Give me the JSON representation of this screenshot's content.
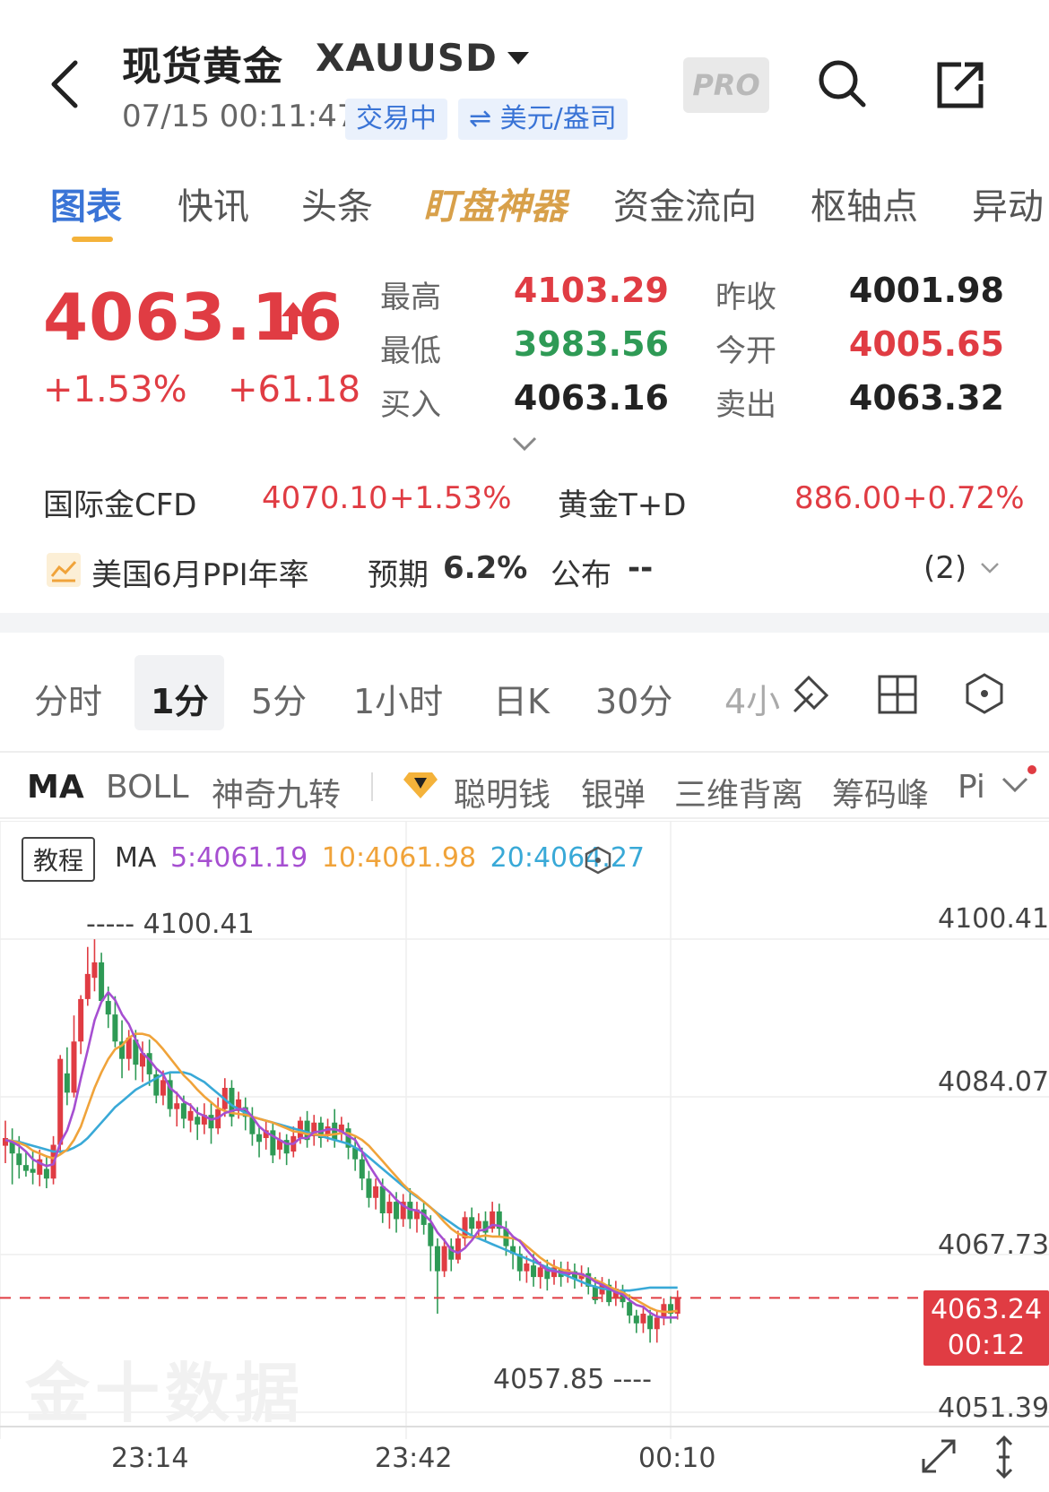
{
  "header": {
    "title": "现货黄金",
    "symbol": "XAUUSD",
    "datetime": "07/15 00:11:47",
    "status_badge": "交易中",
    "currency_badge": "⇌ 美元/盎司",
    "pro_label": "PRO",
    "icons": [
      "back-icon",
      "search-icon",
      "share-icon",
      "caret-down-icon"
    ]
  },
  "tabs": [
    {
      "label": "图表",
      "active": true
    },
    {
      "label": "快讯"
    },
    {
      "label": "头条"
    },
    {
      "label": "盯盘神器",
      "special": true
    },
    {
      "label": "资金流向"
    },
    {
      "label": "枢轴点"
    },
    {
      "label": "异动"
    }
  ],
  "quote": {
    "price": "4063.16",
    "change_pct": "+1.53%",
    "change_abs": "+61.18",
    "stats": [
      {
        "label": "最高",
        "value": "4103.29",
        "color": "red"
      },
      {
        "label": "昨收",
        "value": "4001.98",
        "color": "dark"
      },
      {
        "label": "最低",
        "value": "3983.56",
        "color": "green"
      },
      {
        "label": "今开",
        "value": "4005.65",
        "color": "red"
      },
      {
        "label": "买入",
        "value": "4063.16",
        "color": "dark"
      },
      {
        "label": "卖出",
        "value": "4063.32",
        "color": "dark"
      }
    ]
  },
  "related": [
    {
      "label": "国际金CFD",
      "price": "4070.10",
      "change": "+1.53%"
    },
    {
      "label": "黄金T+D",
      "price": "886.00",
      "change": "+0.72%"
    }
  ],
  "event": {
    "title": "美国6月PPI年率",
    "expected_label": "预期",
    "expected_value": "6.2%",
    "published_label": "公布",
    "published_value": "--",
    "count": "(2)"
  },
  "periods": [
    {
      "label": "分时"
    },
    {
      "label": "1分",
      "active": true
    },
    {
      "label": "5分"
    },
    {
      "label": "1小时"
    },
    {
      "label": "日K"
    },
    {
      "label": "30分"
    },
    {
      "label": "4小"
    }
  ],
  "period_icons": [
    "draw-tool-icon",
    "layout-grid-icon",
    "settings-hex-icon"
  ],
  "indicators": [
    "MA",
    "BOLL",
    "神奇九转",
    "聪明钱",
    "银弹",
    "三维背离",
    "筹码峰",
    "Pi"
  ],
  "chart_header": {
    "tutorial_button": "教程",
    "ma_label": "MA",
    "ma5": "5:4061.19",
    "ma10": "10:4061.98",
    "ma20": "20:4064.27"
  },
  "colors": {
    "up": "#e03c43",
    "down": "#2e9a55",
    "ma5": "#a64fd1",
    "ma10": "#f0a33a",
    "ma20": "#39a9d7",
    "accent": "#3a74d6"
  },
  "chart": {
    "y_axis_labels": [
      "4100.41",
      "4084.07",
      "4067.73",
      "4051.39"
    ],
    "x_axis_labels": [
      "23:14",
      "23:42",
      "00:10"
    ],
    "high_marker": "4100.41",
    "low_marker": "4057.85",
    "current_price_tag": "4063.24",
    "current_countdown": "00:12",
    "watermark": "金十数据"
  },
  "chart_data": {
    "type": "candlestick",
    "interval": "1m",
    "ylim": [
      4051.39,
      4100.41
    ],
    "current_price": 4063.24,
    "candles": [
      {
        "o": 4079.0,
        "c": 4079.8,
        "h": 4081.6,
        "l": 4077.2
      },
      {
        "o": 4079.5,
        "c": 4078.2,
        "h": 4080.8,
        "l": 4075.0
      },
      {
        "o": 4078.2,
        "c": 4077.0,
        "h": 4080.0,
        "l": 4075.6
      },
      {
        "o": 4077.0,
        "c": 4076.4,
        "h": 4078.4,
        "l": 4075.8
      },
      {
        "o": 4076.6,
        "c": 4076.2,
        "h": 4078.5,
        "l": 4075.0
      },
      {
        "o": 4076.0,
        "c": 4077.6,
        "h": 4078.6,
        "l": 4074.8
      },
      {
        "o": 4076.6,
        "c": 4075.6,
        "h": 4078.0,
        "l": 4074.6
      },
      {
        "o": 4075.6,
        "c": 4079.1,
        "h": 4080.0,
        "l": 4075.0
      },
      {
        "o": 4079.1,
        "c": 4088.0,
        "h": 4088.4,
        "l": 4078.0
      },
      {
        "o": 4086.5,
        "c": 4084.5,
        "h": 4089.2,
        "l": 4083.2
      },
      {
        "o": 4084.5,
        "c": 4089.8,
        "h": 4092.5,
        "l": 4084.0
      },
      {
        "o": 4089.8,
        "c": 4094.2,
        "h": 4094.6,
        "l": 4088.5
      },
      {
        "o": 4094.2,
        "c": 4096.8,
        "h": 4099.6,
        "l": 4093.5
      },
      {
        "o": 4096.4,
        "c": 4098.0,
        "h": 4100.4,
        "l": 4095.0
      },
      {
        "o": 4098.0,
        "c": 4094.0,
        "h": 4099.0,
        "l": 4093.8
      },
      {
        "o": 4094.0,
        "c": 4092.6,
        "h": 4095.5,
        "l": 4091.2
      },
      {
        "o": 4092.6,
        "c": 4089.8,
        "h": 4094.5,
        "l": 4089.2
      },
      {
        "o": 4089.8,
        "c": 4088.0,
        "h": 4092.0,
        "l": 4086.0
      },
      {
        "o": 4088.0,
        "c": 4090.2,
        "h": 4091.0,
        "l": 4086.8
      },
      {
        "o": 4090.0,
        "c": 4087.4,
        "h": 4091.0,
        "l": 4085.8
      },
      {
        "o": 4087.2,
        "c": 4088.6,
        "h": 4089.8,
        "l": 4085.6
      },
      {
        "o": 4088.6,
        "c": 4086.4,
        "h": 4090.0,
        "l": 4085.2
      },
      {
        "o": 4086.4,
        "c": 4084.2,
        "h": 4087.0,
        "l": 4083.4
      },
      {
        "o": 4084.2,
        "c": 4085.8,
        "h": 4086.8,
        "l": 4083.2
      },
      {
        "o": 4085.8,
        "c": 4082.8,
        "h": 4086.6,
        "l": 4082.0
      },
      {
        "o": 4082.8,
        "c": 4083.4,
        "h": 4084.6,
        "l": 4081.0
      },
      {
        "o": 4083.4,
        "c": 4081.8,
        "h": 4084.2,
        "l": 4080.8
      },
      {
        "o": 4081.6,
        "c": 4082.6,
        "h": 4083.4,
        "l": 4080.4
      },
      {
        "o": 4082.0,
        "c": 4081.2,
        "h": 4083.0,
        "l": 4079.6
      },
      {
        "o": 4081.2,
        "c": 4082.2,
        "h": 4083.4,
        "l": 4080.2
      },
      {
        "o": 4082.2,
        "c": 4080.8,
        "h": 4083.6,
        "l": 4079.2
      },
      {
        "o": 4080.8,
        "c": 4082.8,
        "h": 4084.0,
        "l": 4080.2
      },
      {
        "o": 4082.8,
        "c": 4085.0,
        "h": 4086.0,
        "l": 4082.0
      },
      {
        "o": 4085.0,
        "c": 4082.0,
        "h": 4085.8,
        "l": 4081.0
      },
      {
        "o": 4082.6,
        "c": 4083.8,
        "h": 4084.6,
        "l": 4081.8
      },
      {
        "o": 4083.0,
        "c": 4082.0,
        "h": 4084.0,
        "l": 4080.6
      },
      {
        "o": 4082.0,
        "c": 4080.2,
        "h": 4083.0,
        "l": 4079.0
      },
      {
        "o": 4080.2,
        "c": 4079.4,
        "h": 4081.0,
        "l": 4077.8
      },
      {
        "o": 4079.8,
        "c": 4080.6,
        "h": 4081.6,
        "l": 4078.6
      },
      {
        "o": 4080.6,
        "c": 4078.0,
        "h": 4081.4,
        "l": 4077.2
      },
      {
        "o": 4078.6,
        "c": 4079.6,
        "h": 4080.4,
        "l": 4077.6
      },
      {
        "o": 4079.6,
        "c": 4078.2,
        "h": 4080.2,
        "l": 4077.0
      },
      {
        "o": 4078.4,
        "c": 4080.0,
        "h": 4081.0,
        "l": 4077.8
      },
      {
        "o": 4079.8,
        "c": 4081.6,
        "h": 4082.0,
        "l": 4079.2
      },
      {
        "o": 4081.6,
        "c": 4079.6,
        "h": 4082.6,
        "l": 4078.8
      },
      {
        "o": 4080.0,
        "c": 4081.4,
        "h": 4082.2,
        "l": 4079.0
      },
      {
        "o": 4081.4,
        "c": 4079.8,
        "h": 4082.0,
        "l": 4078.8
      },
      {
        "o": 4080.0,
        "c": 4081.0,
        "h": 4081.8,
        "l": 4079.4
      },
      {
        "o": 4081.4,
        "c": 4079.6,
        "h": 4082.8,
        "l": 4078.8
      },
      {
        "o": 4080.4,
        "c": 4081.2,
        "h": 4082.0,
        "l": 4079.4
      },
      {
        "o": 4080.8,
        "c": 4078.8,
        "h": 4081.4,
        "l": 4077.6
      },
      {
        "o": 4078.8,
        "c": 4077.6,
        "h": 4080.0,
        "l": 4076.4
      },
      {
        "o": 4077.6,
        "c": 4075.6,
        "h": 4078.8,
        "l": 4074.4
      },
      {
        "o": 4075.6,
        "c": 4073.6,
        "h": 4076.4,
        "l": 4072.6
      },
      {
        "o": 4073.6,
        "c": 4074.8,
        "h": 4075.6,
        "l": 4072.4
      },
      {
        "o": 4074.8,
        "c": 4072.0,
        "h": 4075.6,
        "l": 4071.0
      },
      {
        "o": 4072.0,
        "c": 4073.2,
        "h": 4074.0,
        "l": 4070.4
      },
      {
        "o": 4073.2,
        "c": 4071.4,
        "h": 4074.2,
        "l": 4070.0
      },
      {
        "o": 4071.4,
        "c": 4073.2,
        "h": 4074.0,
        "l": 4070.6
      },
      {
        "o": 4073.2,
        "c": 4071.4,
        "h": 4074.6,
        "l": 4070.4
      },
      {
        "o": 4071.4,
        "c": 4072.4,
        "h": 4073.2,
        "l": 4070.0
      },
      {
        "o": 4072.4,
        "c": 4070.8,
        "h": 4073.2,
        "l": 4069.8
      },
      {
        "o": 4071.0,
        "c": 4068.6,
        "h": 4071.8,
        "l": 4066.0
      },
      {
        "o": 4068.6,
        "c": 4066.0,
        "h": 4069.4,
        "l": 4061.6
      },
      {
        "o": 4066.0,
        "c": 4068.6,
        "h": 4069.4,
        "l": 4065.4
      },
      {
        "o": 4068.6,
        "c": 4067.2,
        "h": 4069.4,
        "l": 4066.0
      },
      {
        "o": 4067.2,
        "c": 4069.4,
        "h": 4070.2,
        "l": 4066.8
      },
      {
        "o": 4069.4,
        "c": 4071.6,
        "h": 4072.2,
        "l": 4068.6
      },
      {
        "o": 4071.6,
        "c": 4070.4,
        "h": 4072.6,
        "l": 4069.6
      },
      {
        "o": 4070.4,
        "c": 4071.2,
        "h": 4072.0,
        "l": 4069.6
      },
      {
        "o": 4071.2,
        "c": 4070.0,
        "h": 4072.2,
        "l": 4069.2
      },
      {
        "o": 4070.4,
        "c": 4072.2,
        "h": 4073.2,
        "l": 4070.0
      },
      {
        "o": 4072.2,
        "c": 4070.4,
        "h": 4073.0,
        "l": 4069.6
      },
      {
        "o": 4070.4,
        "c": 4068.6,
        "h": 4071.2,
        "l": 4067.6
      },
      {
        "o": 4068.6,
        "c": 4067.8,
        "h": 4069.4,
        "l": 4066.2
      },
      {
        "o": 4067.8,
        "c": 4066.0,
        "h": 4068.6,
        "l": 4065.0
      },
      {
        "o": 4066.0,
        "c": 4066.8,
        "h": 4067.6,
        "l": 4064.8
      },
      {
        "o": 4066.6,
        "c": 4065.4,
        "h": 4067.8,
        "l": 4064.4
      },
      {
        "o": 4065.4,
        "c": 4066.4,
        "h": 4067.0,
        "l": 4064.2
      },
      {
        "o": 4066.4,
        "c": 4065.2,
        "h": 4067.2,
        "l": 4064.0
      },
      {
        "o": 4065.4,
        "c": 4066.4,
        "h": 4067.2,
        "l": 4064.6
      },
      {
        "o": 4066.2,
        "c": 4065.4,
        "h": 4067.0,
        "l": 4064.4
      },
      {
        "o": 4065.6,
        "c": 4066.2,
        "h": 4067.0,
        "l": 4064.8
      },
      {
        "o": 4066.0,
        "c": 4065.2,
        "h": 4066.8,
        "l": 4064.2
      },
      {
        "o": 4065.2,
        "c": 4065.8,
        "h": 4066.6,
        "l": 4064.4
      },
      {
        "o": 4065.8,
        "c": 4064.4,
        "h": 4066.4,
        "l": 4063.6
      },
      {
        "o": 4064.4,
        "c": 4063.0,
        "h": 4065.4,
        "l": 4062.6
      },
      {
        "o": 4063.6,
        "c": 4064.8,
        "h": 4065.4,
        "l": 4062.8
      },
      {
        "o": 4064.6,
        "c": 4062.8,
        "h": 4065.2,
        "l": 4062.4
      },
      {
        "o": 4063.2,
        "c": 4064.2,
        "h": 4065.0,
        "l": 4062.4
      },
      {
        "o": 4064.0,
        "c": 4062.8,
        "h": 4064.6,
        "l": 4062.2
      },
      {
        "o": 4062.8,
        "c": 4061.4,
        "h": 4063.6,
        "l": 4060.6
      },
      {
        "o": 4061.4,
        "c": 4060.6,
        "h": 4062.0,
        "l": 4059.6
      },
      {
        "o": 4060.6,
        "c": 4061.6,
        "h": 4062.4,
        "l": 4059.6
      },
      {
        "o": 4061.4,
        "c": 4060.0,
        "h": 4062.0,
        "l": 4058.6
      },
      {
        "o": 4060.0,
        "c": 4061.2,
        "h": 4062.0,
        "l": 4058.6
      },
      {
        "o": 4061.2,
        "c": 4062.6,
        "h": 4063.2,
        "l": 4060.4
      },
      {
        "o": 4062.6,
        "c": 4061.6,
        "h": 4063.4,
        "l": 4060.6
      },
      {
        "o": 4061.6,
        "c": 4063.2,
        "h": 4064.0,
        "l": 4061.0
      }
    ],
    "ma5": [
      4079.6,
      4079.4,
      4079.0,
      4078.4,
      4077.6,
      4077.2,
      4076.9,
      4077.1,
      4079.3,
      4080.6,
      4082.8,
      4086.0,
      4088.9,
      4092.0,
      4093.9,
      4094.9,
      4094.1,
      4092.6,
      4091.6,
      4090.0,
      4088.6,
      4087.9,
      4087.0,
      4086.4,
      4085.0,
      4084.4,
      4083.6,
      4083.2,
      4082.4,
      4082.1,
      4081.7,
      4081.9,
      4082.4,
      4082.6,
      4082.8,
      4082.8,
      4082.0,
      4081.0,
      4080.4,
      4080.0,
      4079.6,
      4079.2,
      4079.2,
      4079.8,
      4079.8,
      4080.4,
      4080.5,
      4080.7,
      4080.7,
      4080.5,
      4080.0,
      4079.6,
      4078.4,
      4077.0,
      4075.9,
      4074.8,
      4074.2,
      4073.4,
      4072.8,
      4072.4,
      4072.3,
      4071.9,
      4071.2,
      4070.0,
      4069.2,
      4068.2,
      4067.9,
      4068.4,
      4069.2,
      4070.2,
      4070.3,
      4070.8,
      4070.7,
      4070.4,
      4069.6,
      4069.1,
      4068.2,
      4067.4,
      4066.7,
      4066.1,
      4066.0,
      4065.9,
      4065.8,
      4065.8,
      4065.7,
      4065.4,
      4064.9,
      4064.6,
      4064.2,
      4063.8,
      4063.6,
      4063.0,
      4062.5,
      4062.3,
      4061.7,
      4061.3,
      4061.2,
      4061.2,
      4061.2
    ],
    "ma10": [
      4079.6,
      4079.5,
      4079.3,
      4079.0,
      4078.5,
      4078.2,
      4077.9,
      4077.7,
      4078.1,
      4078.6,
      4079.6,
      4081.0,
      4083.0,
      4085.0,
      4086.6,
      4088.0,
      4089.0,
      4089.4,
      4090.2,
      4090.6,
      4090.6,
      4090.4,
      4089.8,
      4089.0,
      4088.1,
      4087.2,
      4086.3,
      4085.6,
      4084.8,
      4084.1,
      4083.5,
      4082.9,
      4082.6,
      4082.4,
      4082.3,
      4082.2,
      4082.0,
      4081.8,
      4081.6,
      4081.4,
      4081.1,
      4080.8,
      4080.5,
      4080.4,
      4080.2,
      4080.2,
      4080.1,
      4080.1,
      4080.2,
      4080.3,
      4080.3,
      4080.0,
      4079.6,
      4079.0,
      4078.2,
      4077.4,
      4076.6,
      4075.8,
      4075.0,
      4074.3,
      4073.8,
      4073.2,
      4072.6,
      4071.9,
      4071.1,
      4070.4,
      4069.9,
      4069.6,
      4069.5,
      4069.6,
      4069.7,
      4069.6,
      4069.6,
      4069.5,
      4069.4,
      4069.2,
      4068.6,
      4068.0,
      4067.4,
      4066.9,
      4066.5,
      4066.2,
      4066.0,
      4065.8,
      4065.6,
      4065.4,
      4065.1,
      4064.8,
      4064.4,
      4064.1,
      4063.8,
      4063.4,
      4063.0,
      4062.6,
      4062.2,
      4061.9,
      4061.8,
      4061.8,
      4061.9
    ],
    "ma20": [
      4079.6,
      4079.5,
      4079.4,
      4079.2,
      4079.0,
      4078.8,
      4078.6,
      4078.4,
      4078.4,
      4078.5,
      4078.8,
      4079.2,
      4079.8,
      4080.6,
      4081.4,
      4082.2,
      4083.0,
      4083.6,
      4084.2,
      4084.8,
      4085.2,
      4085.6,
      4086.0,
      4086.4,
      4086.6,
      4086.6,
      4086.6,
      4086.4,
      4086.0,
      4085.6,
      4085.0,
      4084.4,
      4083.8,
      4083.2,
      4082.8,
      4082.4,
      4082.0,
      4081.8,
      4081.6,
      4081.4,
      4081.2,
      4081.0,
      4080.8,
      4080.6,
      4080.4,
      4080.2,
      4080.0,
      4079.8,
      4079.6,
      4079.4,
      4079.2,
      4078.8,
      4078.4,
      4077.8,
      4077.2,
      4076.6,
      4076.0,
      4075.4,
      4074.8,
      4074.2,
      4073.7,
      4073.2,
      4072.6,
      4072.0,
      4071.5,
      4071.0,
      4070.5,
      4070.1,
      4069.7,
      4069.4,
      4069.1,
      4068.8,
      4068.5,
      4068.2,
      4067.9,
      4067.6,
      4067.3,
      4067.0,
      4066.7,
      4066.4,
      4066.1,
      4065.8,
      4065.5,
      4065.2,
      4064.9,
      4064.6,
      4064.4,
      4064.2,
      4064.1,
      4064.0,
      4064.0,
      4064.0,
      4064.1,
      4064.2,
      4064.3,
      4064.3,
      4064.3,
      4064.3,
      4064.3
    ]
  }
}
